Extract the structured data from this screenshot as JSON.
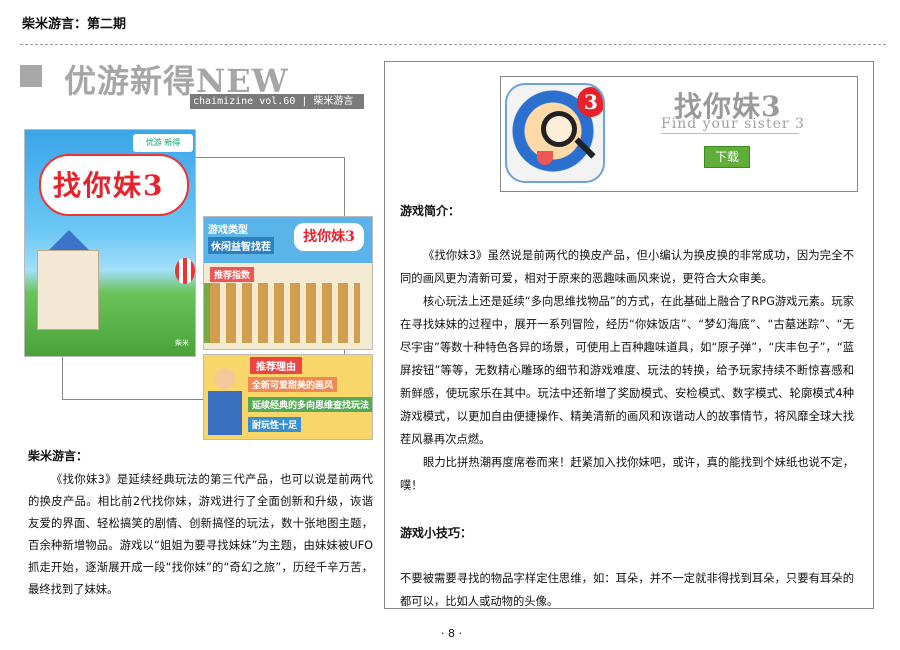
{
  "header": {
    "title": "柴米游言：第二期"
  },
  "section": {
    "title": "优游新得NEW",
    "vol_bar": "chaimizine vol.60 | 柴米游言"
  },
  "screenshots": {
    "main": {
      "badge": "优游 新得",
      "title_text": "找你妹3",
      "corner": "柴米"
    },
    "panel_a": {
      "line1": "游戏类型",
      "line2": "休闲益智找茬",
      "logo": "找你妹3",
      "rec": "推荐指数"
    },
    "panel_b": {
      "reason": "推荐理由",
      "line1": "全新可爱甜美的画风",
      "line2": "延续经典的多向思维查找玩法",
      "line3": "耐玩性十足"
    }
  },
  "left": {
    "label": "柴米游言：",
    "body": "《找你妹3》是延续经典玩法的第三代产品，也可以说是前两代的换皮产品。相比前2代找你妹，游戏进行了全面创新和升级，诙谐友爱的界面、轻松搞笑的剧情、创新搞怪的玩法，数十张地图主题，百余种新增物品。游戏以“姐姐为要寻找妹妹”为主题，由妹妹被UFO抓走开始，逐渐展开成一段“找你妹”的“奇幻之旅”，历经千辛万苦，最终找到了妹妹。"
  },
  "app": {
    "name": "找你妹3",
    "subtitle": "Find your sister 3",
    "download": "下载",
    "icon": "magnifier-face-icon",
    "icon_number": "3"
  },
  "right": {
    "intro_label": "游戏简介：",
    "intro_paragraphs": [
      "《找你妹3》虽然说是前两代的换皮产品，但小编认为换皮换的非常成功，因为完全不同的画风更为清新可爱，相对于原来的恶趣味画风来说，更符合大众审美。",
      "核心玩法上还是延续“多向思维找物品”的方式，在此基础上融合了RPG游戏元素。玩家在寻找妹妹的过程中，展开一系列冒险，经历“你妹饭店”、“梦幻海底”、“古墓迷踪”、“无尽宇宙”等数十种特色各异的场景，可使用上百种趣味道具，如“原子弹”，“庆丰包子”，“蓝屏按钮”等等，无数精心雕琢的细节和游戏难度、玩法的转换，给予玩家持续不断惊喜感和新鲜感，使玩家乐在其中。玩法中还新增了奖励模式、安检模式、数字模式、轮廓模式4种游戏模式，以更加自由便捷操作、精美清新的画风和诙谐动人的故事情节，将风靡全球大找茬风暴再次点燃。",
      "眼力比拼热潮再度席卷而来！赶紧加入找你妹吧，或许，真的能找到个妹纸也说不定，噗！"
    ],
    "tips_label": "游戏小技巧：",
    "tips_paragraphs": [
      "不要被需要寻找的物品字样定住思维，如：耳朵，并不一定就非得找到耳朵，只要有耳朵的都可以，比如人或动物的头像。"
    ]
  },
  "footer": {
    "page": "· 8 ·"
  }
}
